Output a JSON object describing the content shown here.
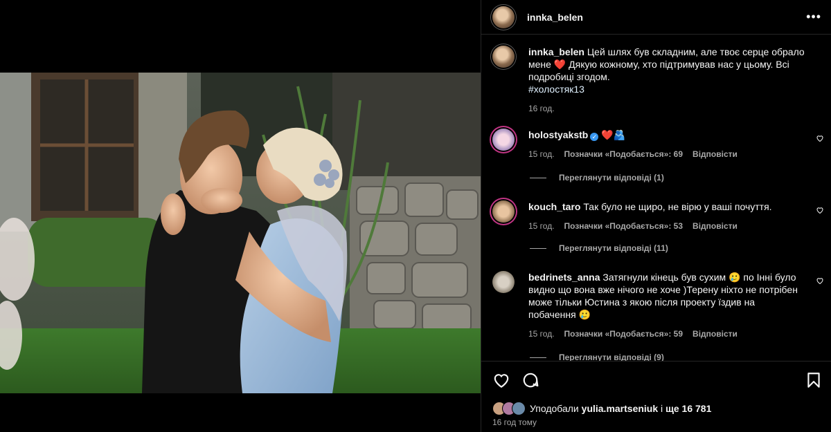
{
  "post": {
    "author": "innka_belen",
    "more_label": "•••",
    "caption": {
      "line": "Цей шлях був складним, але твоє серце обрало мене",
      "heart": "❤️",
      "rest": "Дякую кожному, хто підтримував нас у цьому. Всі подробиці згодом.",
      "hashtag": "#холостяк13",
      "time": "16 год."
    }
  },
  "comments": [
    {
      "user": "holostyakstb",
      "verified": true,
      "text": "❤️🫂",
      "time": "15 год.",
      "likes_label": "Позначки «Подобається»: 69",
      "reply_label": "Відповісти",
      "view_replies": "Переглянути відповіді (1)"
    },
    {
      "user": "kouch_taro",
      "verified": false,
      "text": "Так було не щиро, не вірю у ваші почуття.",
      "time": "15 год.",
      "likes_label": "Позначки «Подобається»: 53",
      "reply_label": "Відповісти",
      "view_replies": "Переглянути відповіді (11)"
    },
    {
      "user": "bedrinets_anna",
      "verified": false,
      "text": "Затягнули кінець був сухим 🥲 по Інні було видно що вона вже нічого не хоче )Терену ніхто не потрібен може тільки Юстина з якою після проекту їздив на побачення 🥲",
      "time": "15 год.",
      "likes_label": "Позначки «Подобається»: 59",
      "reply_label": "Відповісти",
      "view_replies": "Переглянути відповіді (9)"
    }
  ],
  "footer": {
    "liked_prefix": "Уподобали",
    "liked_user": "yulia.martseniuk",
    "liked_and": "і",
    "liked_count": "ще 16 781",
    "posted_ago": "16 год тому"
  },
  "icons": {
    "like": "heart-icon",
    "comment": "comment-icon",
    "save": "bookmark-icon",
    "more": "more-icon",
    "comment_like": "heart-icon"
  },
  "colors": {
    "background": "#000000",
    "text": "#f5f5f5",
    "secondary": "#a8a8a8",
    "border": "#262626",
    "verified": "#3897f0",
    "heart": "#ed1c24"
  }
}
